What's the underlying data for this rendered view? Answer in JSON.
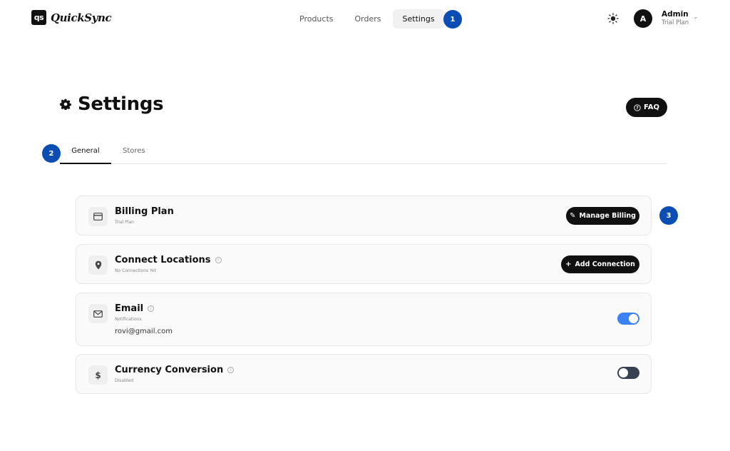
{
  "app": {
    "logo_mark": "qs",
    "logo_text": "QuickSync"
  },
  "nav": {
    "items": [
      {
        "label": "Products"
      },
      {
        "label": "Orders"
      },
      {
        "label": "Settings",
        "active": true
      }
    ]
  },
  "steps": {
    "one": "1",
    "two": "2",
    "three": "3"
  },
  "user": {
    "initial": "A",
    "name": "Admin",
    "plan": "Trial Plan"
  },
  "header": {
    "title": "Settings",
    "faq_label": "FAQ"
  },
  "tabs": [
    {
      "label": "General",
      "active": true
    },
    {
      "label": "Stores"
    }
  ],
  "cards": {
    "billing": {
      "title": "Billing Plan",
      "subtitle": "Trial Plan",
      "button": "Manage Billing",
      "icon": "credit-card-icon"
    },
    "locations": {
      "title": "Connect Locations",
      "subtitle": "No Connections Yet",
      "button": "Add Connection",
      "icon": "map-pin-icon"
    },
    "email": {
      "title": "Email",
      "subtitle": "Notifications",
      "value": "rovi@gmail.com",
      "enabled": true,
      "icon": "mail-icon"
    },
    "currency": {
      "title": "Currency Conversion",
      "subtitle": "Disabled",
      "enabled": false,
      "icon": "dollar-icon"
    }
  },
  "colors": {
    "accent": "#3b82f6",
    "badge": "#0b4db3",
    "dark": "#111111"
  }
}
